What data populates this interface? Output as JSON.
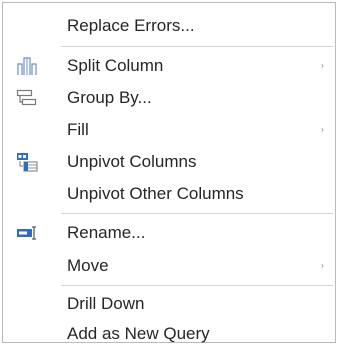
{
  "context_menu": {
    "items": [
      {
        "label": "Replace Errors...",
        "icon": "none",
        "submenu": false
      },
      {
        "label": "Split Column",
        "icon": "split-column-icon",
        "submenu": true
      },
      {
        "label": "Group By...",
        "icon": "group-by-icon",
        "submenu": false
      },
      {
        "label": "Fill",
        "icon": "none",
        "submenu": true
      },
      {
        "label": "Unpivot Columns",
        "icon": "unpivot-columns-icon",
        "submenu": false
      },
      {
        "label": "Unpivot Other Columns",
        "icon": "none",
        "submenu": false
      },
      {
        "label": "Rename...",
        "icon": "rename-icon",
        "submenu": false
      },
      {
        "label": "Move",
        "icon": "none",
        "submenu": true
      },
      {
        "label": "Drill Down",
        "icon": "none",
        "submenu": false
      },
      {
        "label": "Add as New Query",
        "icon": "none",
        "submenu": false
      }
    ],
    "submenu_arrow": "›",
    "colors": {
      "text": "#262626",
      "icon_blue": "#2f6cc4",
      "icon_gray": "#7a7a7a",
      "separator": "#d4d4d4",
      "border": "#b9b9b9"
    }
  }
}
